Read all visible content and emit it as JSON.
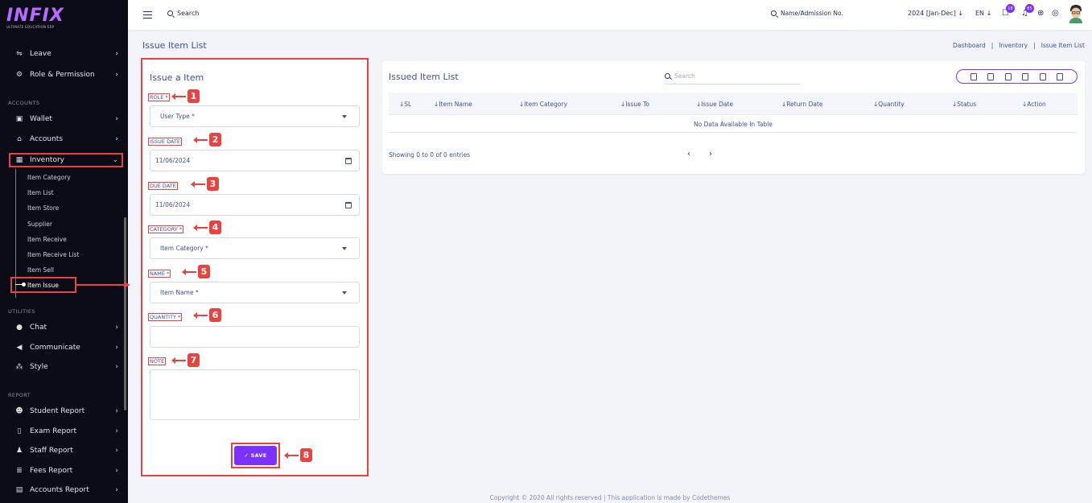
{
  "brand": {
    "logo_text": "INFIX",
    "tagline": "ULTIMATE EDUCATION ERP"
  },
  "sidebar": {
    "items_top": [
      {
        "label": "Leave",
        "icon": "leave-icon"
      },
      {
        "label": "Role & Permission",
        "icon": "role-icon"
      }
    ],
    "sections": {
      "accounts": "ACCOUNTS",
      "utilities": "UTILITIES",
      "report": "REPORT"
    },
    "accounts_items": [
      {
        "label": "Wallet",
        "icon": "wallet-icon"
      },
      {
        "label": "Accounts",
        "icon": "bank-icon"
      },
      {
        "label": "Inventory",
        "icon": "inventory-icon"
      }
    ],
    "inventory_sub": [
      "Item Category",
      "Item List",
      "Item Store",
      "Supplier",
      "Item Receive",
      "Item Receive List",
      "Item Sell",
      "Item Issue"
    ],
    "utilities_items": [
      {
        "label": "Chat",
        "icon": "chat-icon"
      },
      {
        "label": "Communicate",
        "icon": "megaphone-icon"
      },
      {
        "label": "Style",
        "icon": "style-icon"
      }
    ],
    "report_items": [
      {
        "label": "Student Report",
        "icon": "students-icon"
      },
      {
        "label": "Exam Report",
        "icon": "exam-icon"
      },
      {
        "label": "Staff Report",
        "icon": "staff-icon"
      },
      {
        "label": "Fees Report",
        "icon": "fees-icon"
      },
      {
        "label": "Accounts Report",
        "icon": "accounts-report-icon"
      }
    ]
  },
  "header": {
    "search_label": "Search",
    "student_search_label": "Name/Admission No.",
    "session": "2024 [Jan-Dec]",
    "language": "EN",
    "chat_badge": "18",
    "notification_badge": "85"
  },
  "page": {
    "title": "Issue Item List",
    "breadcrumb": [
      "Dashboard",
      "Inventory",
      "Issue Item List"
    ]
  },
  "form": {
    "title": "Issue a Item",
    "role_label": "ROLE *",
    "role_placeholder": "User Type *",
    "issue_date_label": "ISSUE DATE",
    "issue_date_value": "11/06/2024",
    "due_date_label": "DUE DATE",
    "due_date_value": "11/06/2024",
    "category_label": "CATEGORY *",
    "category_placeholder": "Item Category *",
    "name_label": "NAME *",
    "name_placeholder": "Item Name *",
    "quantity_label": "QUANTITY *",
    "quantity_value": "",
    "note_label": "NOTE",
    "note_value": "",
    "save_label": "SAVE",
    "annotations": [
      "1",
      "2",
      "3",
      "4",
      "5",
      "6",
      "7",
      "8"
    ]
  },
  "list": {
    "title": "Issued Item List",
    "search_placeholder": "Search",
    "columns": [
      "SL",
      "Item Name",
      "Item Category",
      "Issue To",
      "Issue Date",
      "Return Date",
      "Quantity",
      "Status",
      "Action"
    ],
    "empty_text": "No Data Available In Table",
    "entries_text": "Showing 0 to 0 of 0 entries",
    "prev": "‹",
    "next": "›"
  },
  "footer": "Copyright © 2020 All rights reserved | This application is made by Codethemes",
  "colors": {
    "primary": "#7c32ff",
    "annotation": "#e9423f",
    "sidebar_bg": "#0b0b17",
    "text": "#415094"
  }
}
